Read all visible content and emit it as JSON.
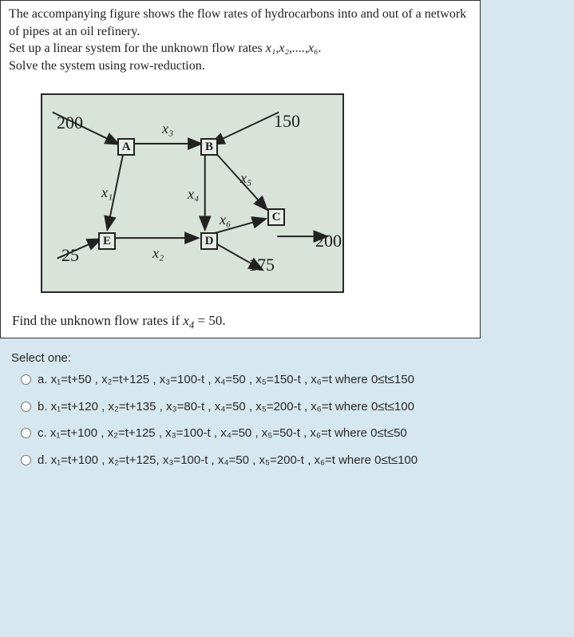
{
  "problem": {
    "line1": "The accompanying figure shows the flow rates of hydrocarbons into and out of a network of pipes at an oil refinery.",
    "line2_pre": "Set up a linear system for the unknown flow rates ",
    "line2_vars": "x₁,x₂,....,x₆.",
    "line3": "Solve the system using row-reduction.",
    "question2": "Find the unknown flow rates if x₄ = 50."
  },
  "figure": {
    "in_top_left": "200",
    "in_top_right": "150",
    "in_bottom_left": "25",
    "out_bottom_right": "200",
    "out_bottom_mid": "175",
    "nodes": {
      "A": "A",
      "B": "B",
      "C": "C",
      "D": "D",
      "E": "E"
    },
    "edges": {
      "x1": "x₁",
      "x2": "x₂",
      "x3": "x₃",
      "x4": "x₄",
      "x5": "x₅",
      "x6": "x₆"
    }
  },
  "answers": {
    "select_label": "Select one:",
    "options": [
      {
        "key": "a",
        "text": "a. x₁=t+50 , x₂=t+125 , x₃=100-t , x₄=50 , x₅=150-t , x₆=t  where 0≤t≤150"
      },
      {
        "key": "b",
        "text": "b. x₁=t+120 , x₂=t+135 , x₃=80-t , x₄=50 , x₅=200-t , x₆=t  where 0≤t≤100"
      },
      {
        "key": "c",
        "text": "c. x₁=t+100 , x₂=t+125 , x₃=100-t , x₄=50 , x₅=50-t , x₆=t  where 0≤t≤50"
      },
      {
        "key": "d",
        "text": "d. x₁=t+100 , x₂=t+125, x₃=100-t , x₄=50 , x₅=200-t , x₆=t  where 0≤t≤100"
      }
    ]
  }
}
